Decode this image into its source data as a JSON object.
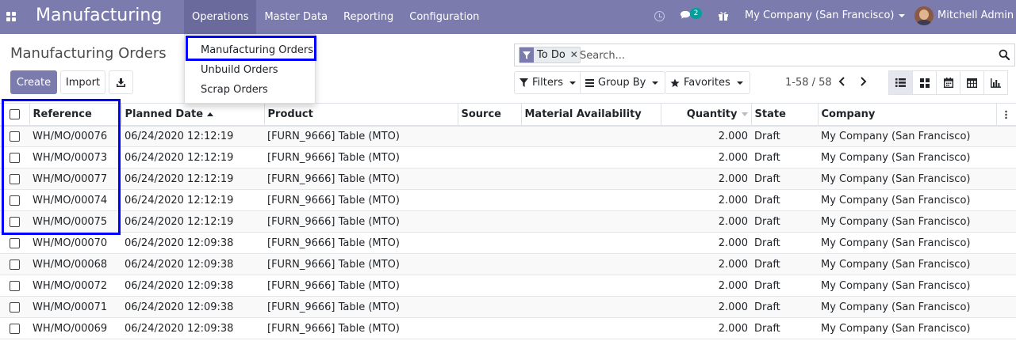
{
  "navbar": {
    "app_title": "Manufacturing",
    "menu": [
      {
        "label": "Operations"
      },
      {
        "label": "Master Data"
      },
      {
        "label": "Reporting"
      },
      {
        "label": "Configuration"
      }
    ],
    "chat_count": "2",
    "company": "My Company (San Francisco)",
    "user": "Mitchell Admin",
    "icons": [
      "apps-icon",
      "clock-icon",
      "chat-icon",
      "gift-icon"
    ],
    "accent_color": "#7c7bad"
  },
  "operations_dropdown": {
    "items": [
      {
        "label": "Manufacturing Orders"
      },
      {
        "label": "Unbuild Orders"
      },
      {
        "label": "Scrap Orders"
      }
    ]
  },
  "control_panel": {
    "title": "Manufacturing Orders",
    "create_label": "Create",
    "import_label": "Import",
    "search": {
      "facet": "To Do",
      "placeholder": "Search..."
    },
    "filters_label": "Filters",
    "group_by_label": "Group By",
    "favorites_label": "Favorites",
    "pager": "1-58 / 58",
    "views": [
      "list-view-icon",
      "kanban-view-icon",
      "calendar-view-icon",
      "pivot-view-icon",
      "graph-view-icon"
    ]
  },
  "table": {
    "headers": {
      "reference": "Reference",
      "planned_date": "Planned Date",
      "product": "Product",
      "source": "Source",
      "material_availability": "Material Availability",
      "quantity": "Quantity",
      "state": "State",
      "company": "Company"
    },
    "rows": [
      {
        "reference": "WH/MO/00076",
        "planned_date": "06/24/2020 12:12:19",
        "product": "[FURN_9666] Table (MTO)",
        "source": "",
        "material_availability": "",
        "quantity": "2.000",
        "state": "Draft",
        "company": "My Company (San Francisco)"
      },
      {
        "reference": "WH/MO/00073",
        "planned_date": "06/24/2020 12:12:19",
        "product": "[FURN_9666] Table (MTO)",
        "source": "",
        "material_availability": "",
        "quantity": "2.000",
        "state": "Draft",
        "company": "My Company (San Francisco)"
      },
      {
        "reference": "WH/MO/00077",
        "planned_date": "06/24/2020 12:12:19",
        "product": "[FURN_9666] Table (MTO)",
        "source": "",
        "material_availability": "",
        "quantity": "2.000",
        "state": "Draft",
        "company": "My Company (San Francisco)"
      },
      {
        "reference": "WH/MO/00074",
        "planned_date": "06/24/2020 12:12:19",
        "product": "[FURN_9666] Table (MTO)",
        "source": "",
        "material_availability": "",
        "quantity": "2.000",
        "state": "Draft",
        "company": "My Company (San Francisco)"
      },
      {
        "reference": "WH/MO/00075",
        "planned_date": "06/24/2020 12:12:19",
        "product": "[FURN_9666] Table (MTO)",
        "source": "",
        "material_availability": "",
        "quantity": "2.000",
        "state": "Draft",
        "company": "My Company (San Francisco)"
      },
      {
        "reference": "WH/MO/00070",
        "planned_date": "06/24/2020 12:09:38",
        "product": "[FURN_9666] Table (MTO)",
        "source": "",
        "material_availability": "",
        "quantity": "2.000",
        "state": "Draft",
        "company": "My Company (San Francisco)"
      },
      {
        "reference": "WH/MO/00068",
        "planned_date": "06/24/2020 12:09:38",
        "product": "[FURN_9666] Table (MTO)",
        "source": "",
        "material_availability": "",
        "quantity": "2.000",
        "state": "Draft",
        "company": "My Company (San Francisco)"
      },
      {
        "reference": "WH/MO/00072",
        "planned_date": "06/24/2020 12:09:38",
        "product": "[FURN_9666] Table (MTO)",
        "source": "",
        "material_availability": "",
        "quantity": "2.000",
        "state": "Draft",
        "company": "My Company (San Francisco)"
      },
      {
        "reference": "WH/MO/00071",
        "planned_date": "06/24/2020 12:09:38",
        "product": "[FURN_9666] Table (MTO)",
        "source": "",
        "material_availability": "",
        "quantity": "2.000",
        "state": "Draft",
        "company": "My Company (San Francisco)"
      },
      {
        "reference": "WH/MO/00069",
        "planned_date": "06/24/2020 12:09:38",
        "product": "[FURN_9666] Table (MTO)",
        "source": "",
        "material_availability": "",
        "quantity": "2.000",
        "state": "Draft",
        "company": "My Company (San Francisco)"
      }
    ]
  },
  "annotation_color": "#0000ff"
}
